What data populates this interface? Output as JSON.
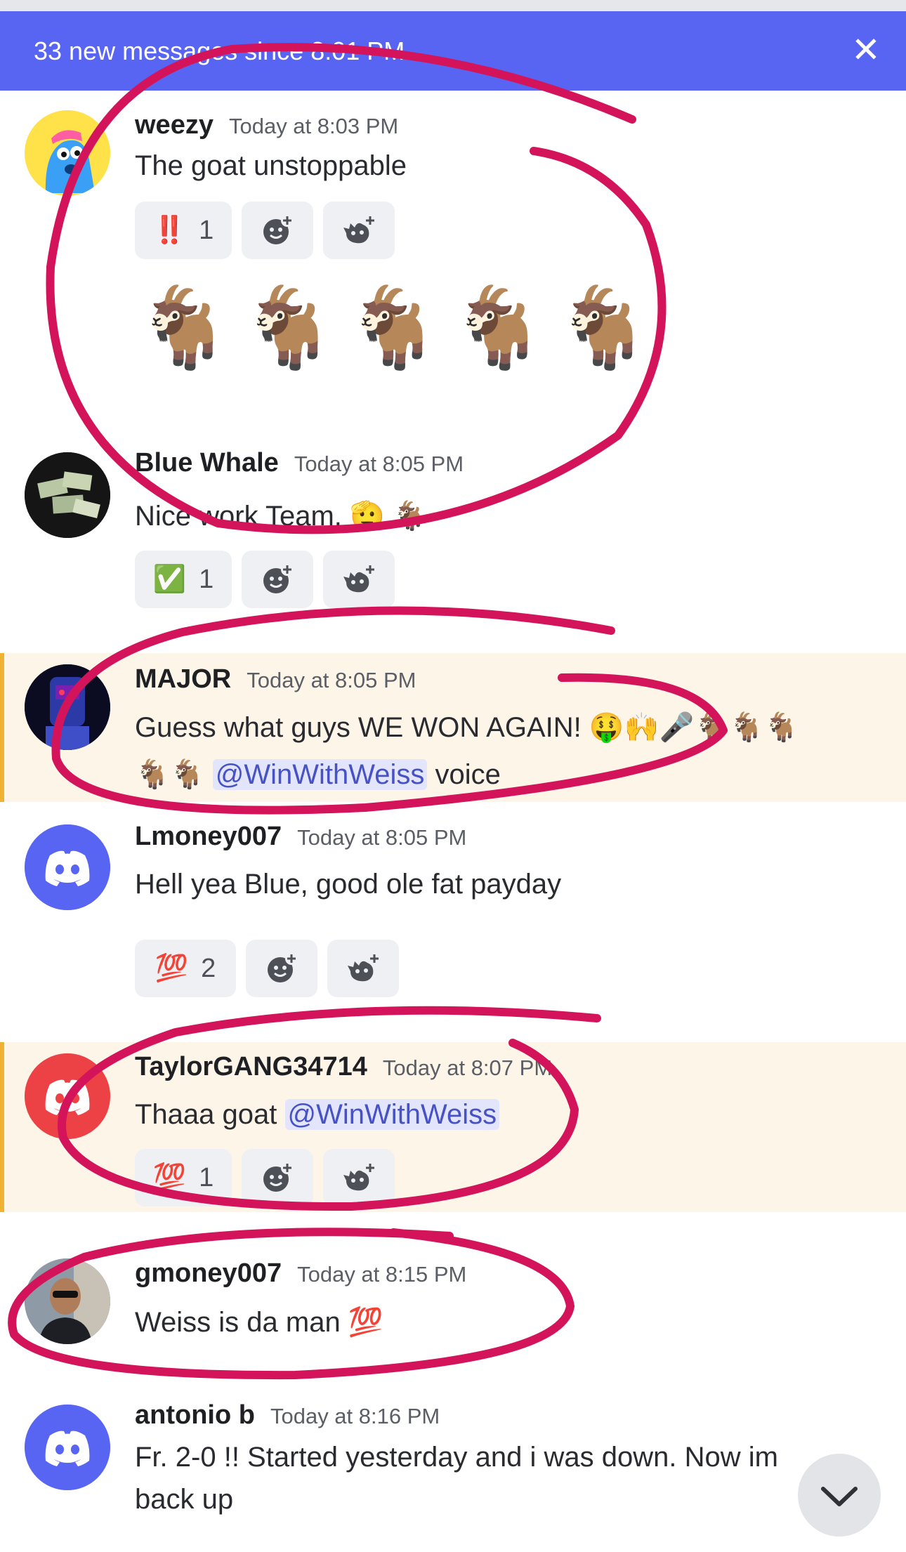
{
  "banner": {
    "text": "33 new messages since 8:01 PM",
    "close_label": "✕",
    "color": "#5865f2"
  },
  "messages": [
    {
      "author": "weezy",
      "time": "Today at 8:03 PM",
      "text": "The goat unstoppable",
      "reactions": [
        {
          "emoji": "‼️",
          "count": "1"
        }
      ],
      "big_emoji": "🐐🐐🐐🐐🐐"
    },
    {
      "author": "Blue Whale",
      "time": "Today at 8:05 PM",
      "text": "Nice work Team. 🫡 🐐",
      "reactions": [
        {
          "emoji": "✅",
          "count": "1"
        }
      ]
    },
    {
      "author": "MAJOR",
      "time": "Today at 8:05 PM",
      "text_line1": "Guess what guys WE WON AGAIN!  🤑🙌🎤🐐🐐🐐",
      "text_line2_prefix": "🐐🐐 ",
      "mention": "@WinWithWeiss",
      "text_line2_suffix": " voice"
    },
    {
      "author": "Lmoney007",
      "time": "Today at 8:05 PM",
      "text": "Hell yea Blue, good ole fat payday",
      "reactions": [
        {
          "emoji": "💯",
          "count": "2"
        }
      ]
    },
    {
      "author": "TaylorGANG34714",
      "time": "Today at 8:07 PM",
      "text_prefix": "Thaaa goat ",
      "mention": "@WinWithWeiss",
      "reactions": [
        {
          "emoji": "💯",
          "count": "1"
        }
      ]
    },
    {
      "author": "gmoney007",
      "time": "Today at 8:15 PM",
      "text": "Weiss is da man 💯"
    },
    {
      "author": "antonio b",
      "time": "Today at 8:16 PM",
      "text_line1": "Fr. 2-0 !! Started yesterday and i was down. Now im",
      "text_line2": "back up"
    }
  ],
  "colors": {
    "highlight_bg": "#fdf5e8",
    "highlight_bar": "#f0b232",
    "mention_bg": "#e3e5fc",
    "mention_text": "#4752c4",
    "annotation": "#d4145a",
    "discord_blurple": "#5865f2",
    "discord_red": "#ed4245"
  },
  "icons": [
    "add-reaction-icon",
    "super-reaction-icon",
    "discord-logo-icon",
    "chevron-down-icon",
    "close-icon"
  ]
}
